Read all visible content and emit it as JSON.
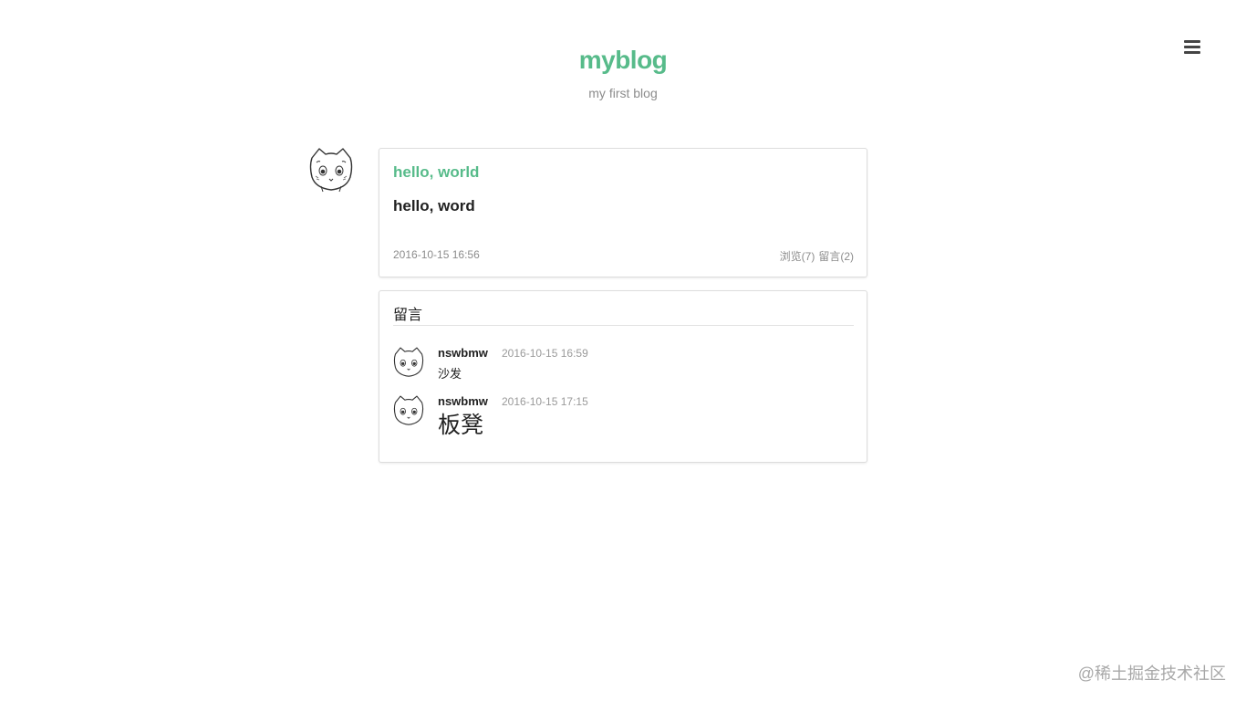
{
  "site": {
    "title": "myblog",
    "subtitle": "my first blog"
  },
  "header": {
    "menu_icon": "hamburger-menu-icon"
  },
  "post": {
    "title": "hello, world",
    "body": "hello, word",
    "time": "2016-10-15 16:56",
    "views": "浏览(7)",
    "comments": "留言(2)"
  },
  "comments_section": {
    "title": "留言",
    "items": [
      {
        "author": "nswbmw",
        "time": "2016-10-15 16:59",
        "content": "沙发"
      },
      {
        "author": "nswbmw",
        "time": "2016-10-15 17:15",
        "content": "板凳"
      }
    ]
  },
  "watermark": "@稀土掘金技术社区",
  "colors": {
    "accent": "#57bb8a",
    "muted": "#8c8c8c",
    "border": "#dddddd"
  }
}
